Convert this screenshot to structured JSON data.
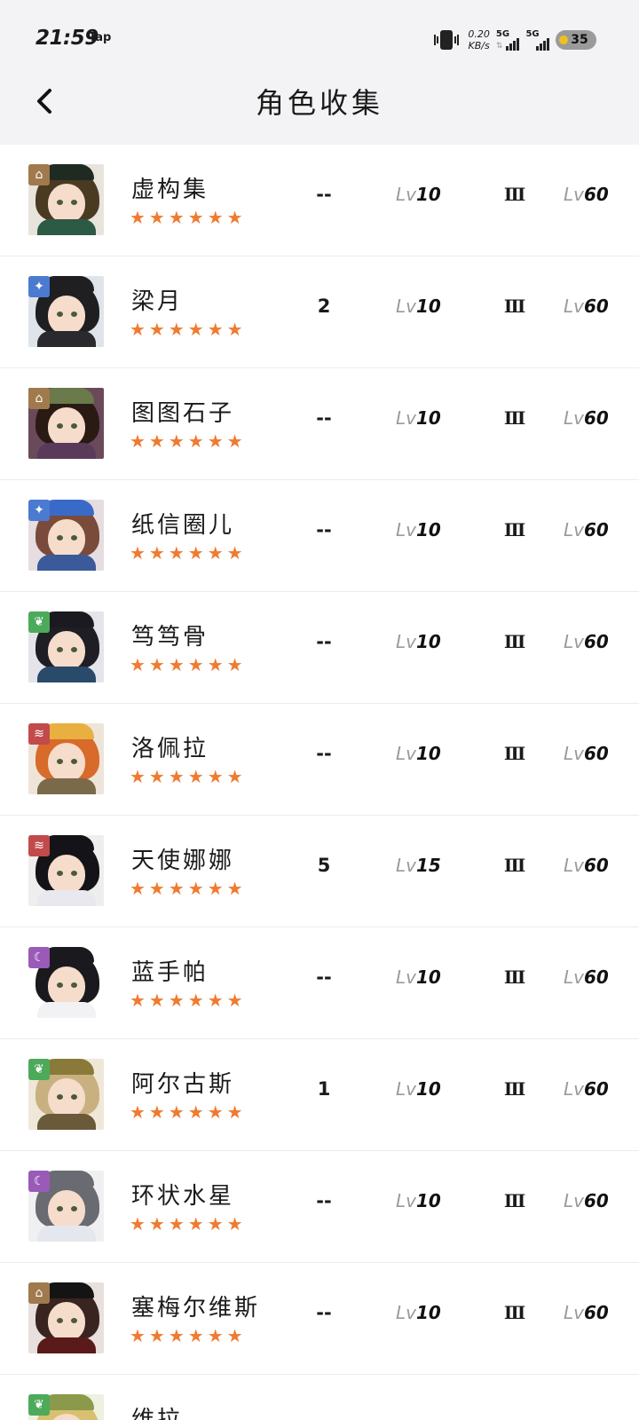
{
  "status_bar": {
    "time": "21:59",
    "app": "Tap",
    "net_speed_value": "0.20",
    "net_speed_unit": "KB/s",
    "signal_1": "5G",
    "signal_2": "5G",
    "battery": "35"
  },
  "header": {
    "title": "角色收集",
    "back_icon": "chevron-left-icon"
  },
  "colors": {
    "star": "#ef7b2f",
    "header_bg": "#f3f3f5",
    "lv_prefix": "#9a9a9a"
  },
  "characters": [
    {
      "name": "虚构集",
      "stars": "★★★★★★",
      "insight": "--",
      "level_prefix": "Lv",
      "level": "10",
      "tier": "Ⅲ",
      "max_prefix": "Lv",
      "max_level": "60",
      "badge": "house-icon",
      "badge_glyph": "⌂",
      "badge_color": "#a07a4c"
    },
    {
      "name": "梁月",
      "stars": "★★★★★★",
      "insight": "2",
      "level_prefix": "Lv",
      "level": "10",
      "tier": "Ⅲ",
      "max_prefix": "Lv",
      "max_level": "60",
      "badge": "star-compass-icon",
      "badge_glyph": "✦",
      "badge_color": "#4a7bd0"
    },
    {
      "name": "图图石子",
      "stars": "★★★★★★",
      "insight": "--",
      "level_prefix": "Lv",
      "level": "10",
      "tier": "Ⅲ",
      "max_prefix": "Lv",
      "max_level": "60",
      "badge": "house-icon",
      "badge_glyph": "⌂",
      "badge_color": "#a07a4c"
    },
    {
      "name": "纸信圈儿",
      "stars": "★★★★★★",
      "insight": "--",
      "level_prefix": "Lv",
      "level": "10",
      "tier": "Ⅲ",
      "max_prefix": "Lv",
      "max_level": "60",
      "badge": "star-compass-icon",
      "badge_glyph": "✦",
      "badge_color": "#4a7bd0"
    },
    {
      "name": "笃笃骨",
      "stars": "★★★★★★",
      "insight": "--",
      "level_prefix": "Lv",
      "level": "10",
      "tier": "Ⅲ",
      "max_prefix": "Lv",
      "max_level": "60",
      "badge": "leaf-icon",
      "badge_glyph": "❦",
      "badge_color": "#4caa5a"
    },
    {
      "name": "洛佩拉",
      "stars": "★★★★★★",
      "insight": "--",
      "level_prefix": "Lv",
      "level": "10",
      "tier": "Ⅲ",
      "max_prefix": "Lv",
      "max_level": "60",
      "badge": "claw-icon",
      "badge_glyph": "≋",
      "badge_color": "#c24a4a"
    },
    {
      "name": "天使娜娜",
      "stars": "★★★★★★",
      "insight": "5",
      "level_prefix": "Lv",
      "level": "15",
      "tier": "Ⅲ",
      "max_prefix": "Lv",
      "max_level": "60",
      "badge": "claw-icon",
      "badge_glyph": "≋",
      "badge_color": "#c24a4a"
    },
    {
      "name": "蓝手帕",
      "stars": "★★★★★★",
      "insight": "--",
      "level_prefix": "Lv",
      "level": "10",
      "tier": "Ⅲ",
      "max_prefix": "Lv",
      "max_level": "60",
      "badge": "moon-icon",
      "badge_glyph": "☾",
      "badge_color": "#9a5ab8"
    },
    {
      "name": "阿尔古斯",
      "stars": "★★★★★★",
      "insight": "1",
      "level_prefix": "Lv",
      "level": "10",
      "tier": "Ⅲ",
      "max_prefix": "Lv",
      "max_level": "60",
      "badge": "leaf-icon",
      "badge_glyph": "❦",
      "badge_color": "#4caa5a"
    },
    {
      "name": "环状水星",
      "stars": "★★★★★★",
      "insight": "--",
      "level_prefix": "Lv",
      "level": "10",
      "tier": "Ⅲ",
      "max_prefix": "Lv",
      "max_level": "60",
      "badge": "moon-icon",
      "badge_glyph": "☾",
      "badge_color": "#9a5ab8"
    },
    {
      "name": "塞梅尔维斯",
      "stars": "★★★★★★",
      "insight": "--",
      "level_prefix": "Lv",
      "level": "10",
      "tier": "Ⅲ",
      "max_prefix": "Lv",
      "max_level": "60",
      "badge": "house-icon",
      "badge_glyph": "⌂",
      "badge_color": "#a07a4c"
    },
    {
      "name": "维拉",
      "stars": "★★★★★★",
      "insight": "",
      "level_prefix": "",
      "level": "",
      "tier": "",
      "max_prefix": "",
      "max_level": "",
      "badge": "leaf-icon",
      "badge_glyph": "❦",
      "badge_color": "#4caa5a"
    }
  ]
}
